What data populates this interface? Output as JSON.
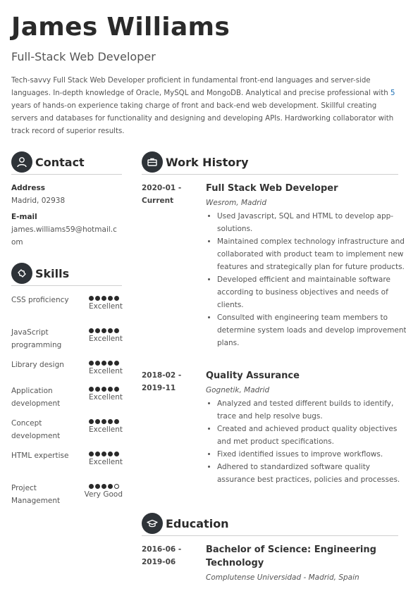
{
  "header": {
    "name": "James Williams",
    "title": "Full-Stack Web Developer",
    "summary_pre": "Tech-savvy Full Stack Web Developer proficient in fundamental front-end languages and server-side languages. In-depth knowledge of Oracle, MySQL and MongoDB. Analytical and precise professional with ",
    "summary_num": "5",
    "summary_post": " years of hands-on experience taking charge of front and back-end web development. Skillful creating servers and databases for functionality and designing and developing APIs. Hardworking collaborator with track record of superior results."
  },
  "contact": {
    "heading": "Contact",
    "address_label": "Address",
    "address_value": "Madrid, 02938",
    "email_label": "E-mail",
    "email_line1": "james.williams59@hotmail.c",
    "email_line2": "om"
  },
  "skills": {
    "heading": "Skills",
    "items": [
      {
        "name": "CSS proficiency",
        "level": "Excellent",
        "rating": 5
      },
      {
        "name": "JavaScript programming",
        "level": "Excellent",
        "rating": 5
      },
      {
        "name": "Library design",
        "level": "Excellent",
        "rating": 5
      },
      {
        "name": "Application development",
        "level": "Excellent",
        "rating": 5
      },
      {
        "name": "Concept development",
        "level": "Excellent",
        "rating": 5
      },
      {
        "name": "HTML expertise",
        "level": "Excellent",
        "rating": 5
      },
      {
        "name": "Project Management",
        "level": "Very Good",
        "rating": 4
      }
    ]
  },
  "work": {
    "heading": "Work History",
    "jobs": [
      {
        "date_start": "2020-01 -",
        "date_end": "Current",
        "title": "Full Stack Web Developer",
        "company": "Wesrom, Madrid",
        "bullets": [
          "Used Javascript, SQL and HTML to develop app-solutions.",
          "Maintained complex technology infrastructure and collaborated with product team to implement new features and strategically plan for future products.",
          "Developed efficient and maintainable software according to business objectives and needs of clients.",
          "Consulted with engineering team members to determine system loads and develop improvement plans."
        ]
      },
      {
        "date_start": "2018-02 -",
        "date_end": "2019-11",
        "title": "Quality Assurance",
        "company": "Gognetik, Madrid",
        "bullets": [
          "Analyzed and tested different builds to identify, trace and help resolve bugs.",
          "Created and achieved product quality objectives and met product specifications.",
          "Fixed identified issues to improve workflows.",
          "Adhered to standardized software quality assurance best practices, policies and processes."
        ]
      }
    ]
  },
  "education": {
    "heading": "Education",
    "items": [
      {
        "date_start": "2016-06 -",
        "date_end": "2019-06",
        "degree": "Bachelor of Science: Engineering Technology",
        "school": "Complutense Universidad - Madrid, Spain"
      }
    ]
  }
}
